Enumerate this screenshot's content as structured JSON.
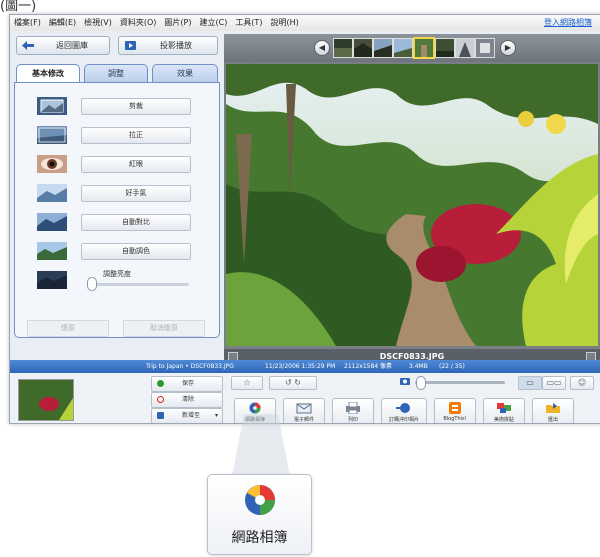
{
  "caption_text": "(圖一)",
  "menu": {
    "items": [
      "檔案(F)",
      "編輯(E)",
      "檢視(V)",
      "資料夾(O)",
      "圖片(P)",
      "建立(C)",
      "工具(T)",
      "說明(H)"
    ],
    "signin": "登入網路相簿"
  },
  "left_panel": {
    "back_label": "返回圖庫",
    "slideshow_label": "投影播放",
    "tabs": [
      "基本修改",
      "調整",
      "效果"
    ],
    "fixes": [
      "剪裁",
      "拉正",
      "紅眼",
      "好手氣",
      "自動對比",
      "自動調色"
    ],
    "slider_label": "調整亮度",
    "undo_label": "復原",
    "redo_label": "取消復原"
  },
  "viewer": {
    "filename": "DSCF0833.JPG"
  },
  "status": {
    "album": "Trip to Japan • DSCF0833.JPG",
    "datetime": "11/23/2006 1:35:29 PM",
    "dimensions": "2112x1584 像素",
    "size": "3.4MB",
    "position": "(22 / 35)"
  },
  "tray": {
    "hold_label": "保存",
    "clear_label": "清除",
    "add_label": "新增至"
  },
  "actions": [
    "網路相簿",
    "電子郵件",
    "列印",
    "訂購沖印相片",
    "BlogThis!",
    "美術拼貼",
    "匯出"
  ],
  "callout": {
    "label": "網路相簿"
  }
}
